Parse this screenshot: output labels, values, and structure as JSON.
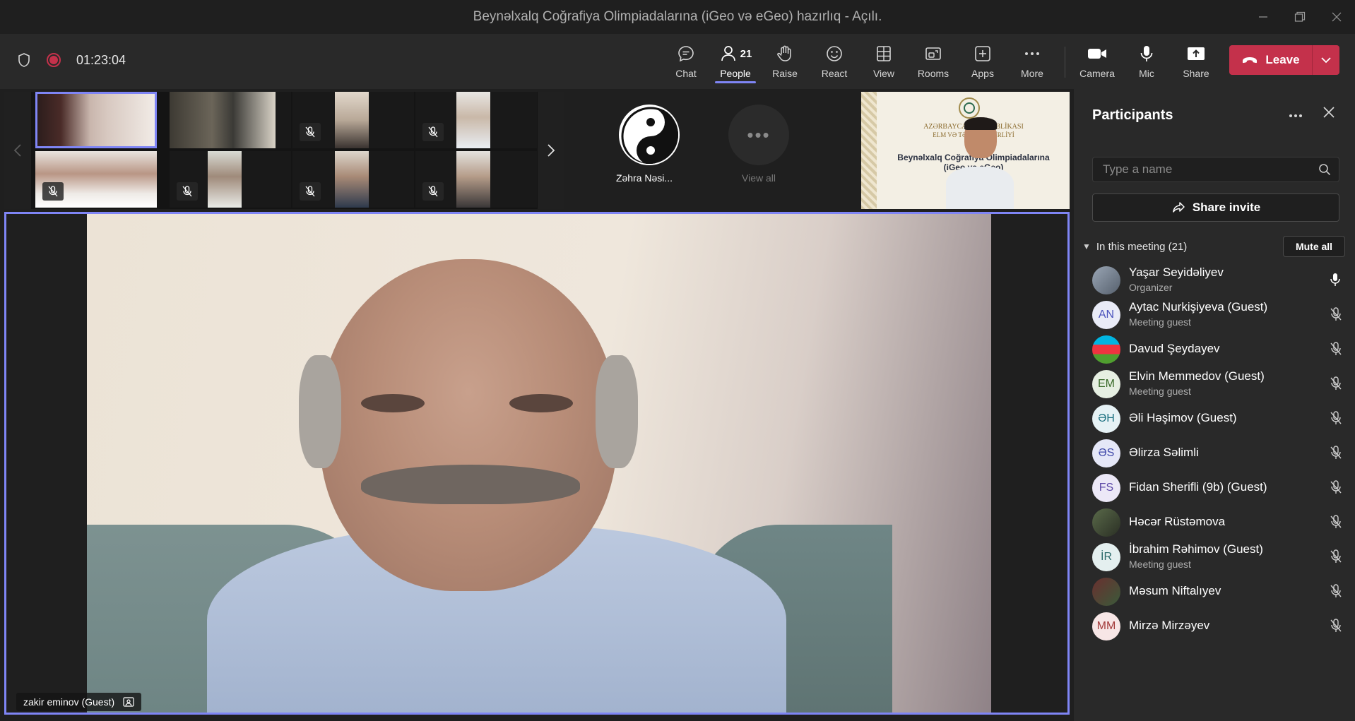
{
  "window": {
    "title": "Beynəlxalq Coğrafiya Olimpiadalarına (iGeo və eGeo) hazırlıq - Açılı."
  },
  "meeting": {
    "timer": "01:23:04",
    "toolbar": {
      "chat": "Chat",
      "people": "People",
      "people_count": "21",
      "raise": "Raise",
      "react": "React",
      "view": "View",
      "rooms": "Rooms",
      "apps": "Apps",
      "more": "More",
      "camera": "Camera",
      "mic": "Mic",
      "share": "Share",
      "leave": "Leave"
    }
  },
  "stage": {
    "featured_person": "Zəhra Nəsi...",
    "view_all": "View all",
    "share_tile_lines": [
      "AZƏRBAYCAN RESPUBLİKASI",
      "ELM VƏ TƏHSİL NAZİRLİYİ",
      "Beynəlxalq Coğrafiya Olimpiadalarına",
      "(iGeo və eGeo)"
    ],
    "main_speaker": "zakir eminov (Guest)"
  },
  "participants": {
    "title": "Participants",
    "search_placeholder": "Type a name",
    "share_invite": "Share invite",
    "section_title": "In this meeting (21)",
    "mute_all": "Mute all",
    "list": [
      {
        "name": "Yaşar Seyidəliyev",
        "role": "Organizer",
        "initials": "",
        "avatar": "photo",
        "mic": "on"
      },
      {
        "name": "Aytac Nurkişiyeva (Guest)",
        "role": "Meeting guest",
        "initials": "AN",
        "avatar": "initials",
        "mic": "off"
      },
      {
        "name": "Davud Şeydayev",
        "role": "",
        "initials": "",
        "avatar": "flag",
        "mic": "off"
      },
      {
        "name": "Elvin Memmedov (Guest)",
        "role": "Meeting guest",
        "initials": "EM",
        "avatar": "initials",
        "mic": "off"
      },
      {
        "name": "Əli Həşimov (Guest)",
        "role": "",
        "initials": "ƏH",
        "avatar": "initials",
        "mic": "off"
      },
      {
        "name": "Əlirza Səlimli",
        "role": "",
        "initials": "ƏS",
        "avatar": "initials",
        "mic": "off"
      },
      {
        "name": "Fidan Sherifli (9b) (Guest)",
        "role": "",
        "initials": "FS",
        "avatar": "initials",
        "mic": "off"
      },
      {
        "name": "Həcər Rüstəmova",
        "role": "",
        "initials": "",
        "avatar": "photo",
        "mic": "off"
      },
      {
        "name": "İbrahim Rəhimov (Guest)",
        "role": "Meeting guest",
        "initials": "İR",
        "avatar": "initials",
        "mic": "off"
      },
      {
        "name": "Məsum Niftalıyev",
        "role": "",
        "initials": "",
        "avatar": "photo",
        "mic": "off"
      },
      {
        "name": "Mirzə Mirzəyev",
        "role": "",
        "initials": "MM",
        "avatar": "initials",
        "mic": "off"
      }
    ]
  },
  "colors": {
    "accent": "#7f85f5",
    "leave": "#c4314b",
    "panel_bg": "#292929",
    "stage_bg": "#1f1f1f"
  }
}
